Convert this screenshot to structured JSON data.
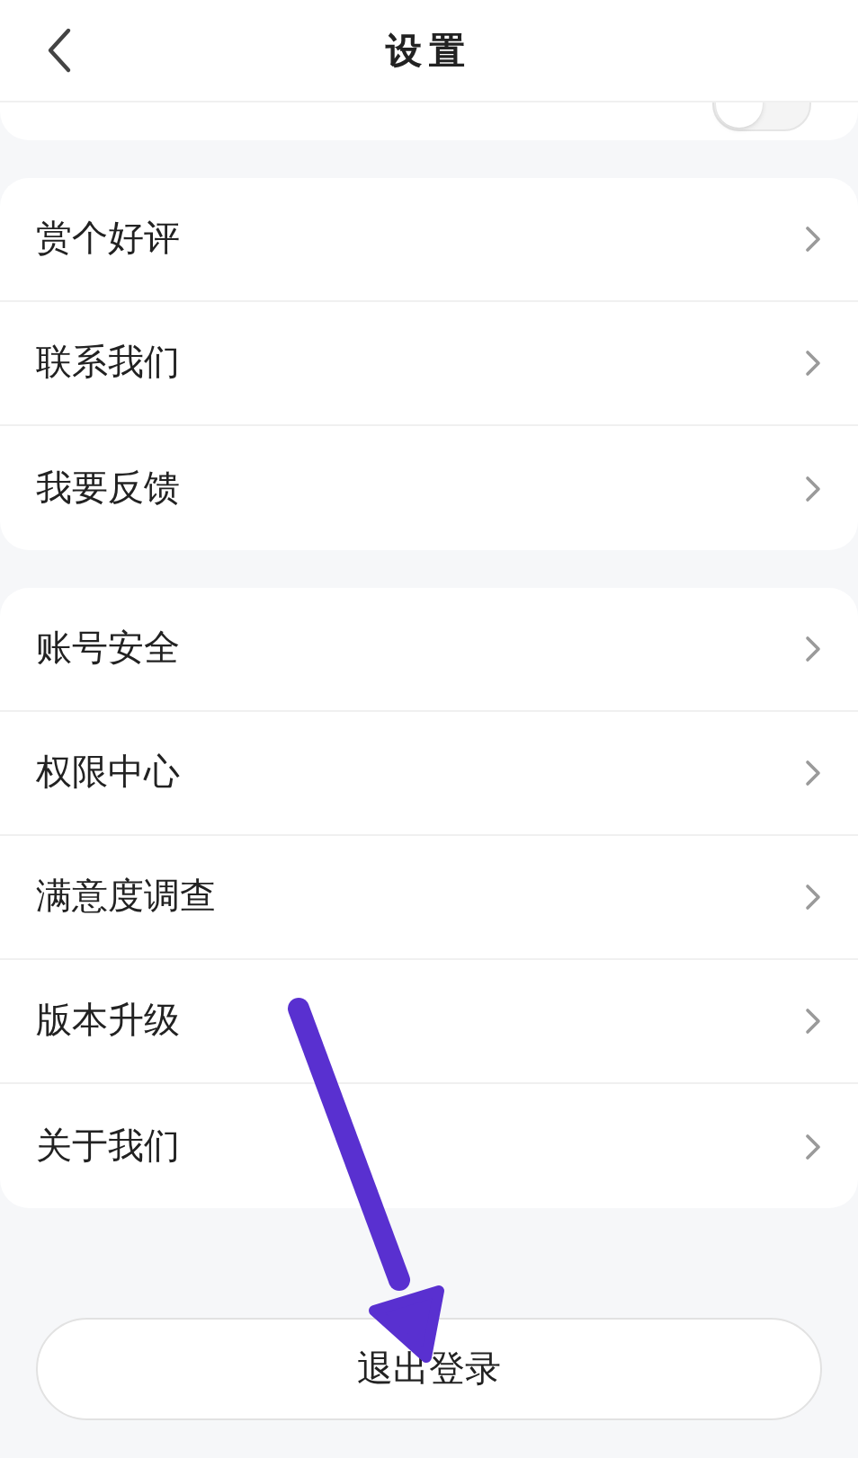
{
  "header": {
    "title": "设置"
  },
  "top_card": {
    "toggle_on": false
  },
  "groups": [
    {
      "items": [
        {
          "label": "赏个好评"
        },
        {
          "label": "联系我们"
        },
        {
          "label": "我要反馈"
        }
      ]
    },
    {
      "items": [
        {
          "label": "账号安全"
        },
        {
          "label": "权限中心"
        },
        {
          "label": "满意度调查"
        },
        {
          "label": "版本升级"
        },
        {
          "label": "关于我们"
        }
      ]
    }
  ],
  "logout_button": "退出登录"
}
